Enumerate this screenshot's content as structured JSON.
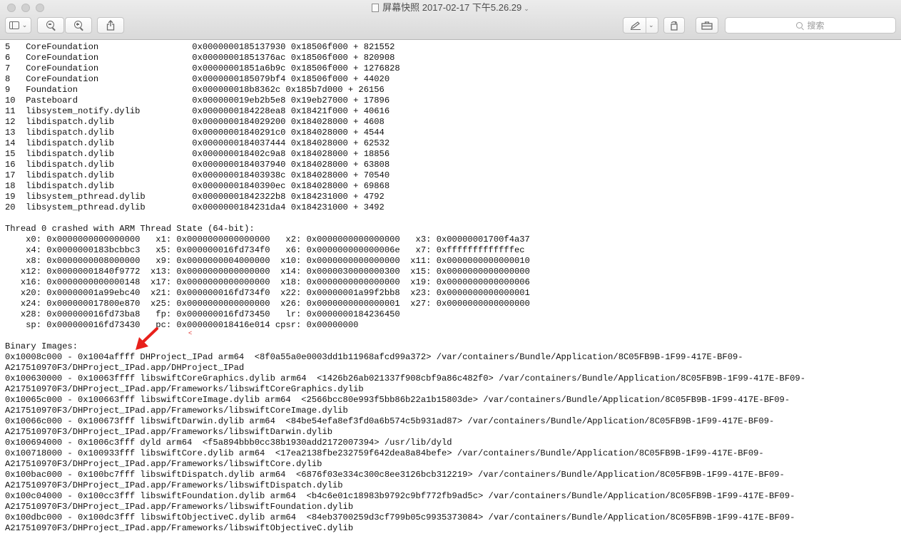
{
  "window": {
    "title": "屏幕快照 2017-02-17 下午5.26.29",
    "search_placeholder": "搜索"
  },
  "toolbar": {
    "sidebar_button": "sidebar-toggle",
    "zoom_out_button": "zoom-out",
    "zoom_in_button": "zoom-in",
    "share_button": "share",
    "markup_button": "markup-pen",
    "rotate_button": "rotate",
    "toolbox_button": "toolbox"
  },
  "annotation": {
    "arrow_color": "#e8201b",
    "mark": "<"
  },
  "log": {
    "lines": [
      "5   CoreFoundation                  0x0000000185137930 0x18506f000 + 821552",
      "6   CoreFoundation                  0x00000001851376ac 0x18506f000 + 820908",
      "7   CoreFoundation                  0x00000001851a6b9c 0x18506f000 + 1276828",
      "8   CoreFoundation                  0x0000000185079bf4 0x18506f000 + 44020",
      "9   Foundation                      0x000000018b8362c 0x185b7d000 + 26156",
      "10  Pasteboard                      0x000000019eb2b5e8 0x19eb27000 + 17896",
      "11  libsystem_notify.dylib          0x0000000184228ea8 0x18421f000 + 40616",
      "12  libdispatch.dylib               0x0000000184029200 0x184028000 + 4608",
      "13  libdispatch.dylib               0x00000001840291c0 0x184028000 + 4544",
      "14  libdispatch.dylib               0x0000000184037444 0x184028000 + 62532",
      "15  libdispatch.dylib               0x000000018402c9a8 0x184028000 + 18856",
      "16  libdispatch.dylib               0x0000000184037940 0x184028000 + 63808",
      "17  libdispatch.dylib               0x000000018403938c 0x184028000 + 70540",
      "18  libdispatch.dylib               0x00000001840390ec 0x184028000 + 69868",
      "19  libsystem_pthread.dylib         0x00000001842322b8 0x184231000 + 4792",
      "20  libsystem_pthread.dylib         0x0000000184231da4 0x184231000 + 3492",
      "",
      "Thread 0 crashed with ARM Thread State (64-bit):",
      "    x0: 0x0000000000000000   x1: 0x0000000000000000   x2: 0x0000000000000000   x3: 0x00000001700f4a37",
      "    x4: 0x0000000183bcbbc3   x5: 0x000000016fd734f0   x6: 0x000000000000006e   x7: 0xfffffffffffffec",
      "    x8: 0x0000000008000000   x9: 0x0000000004000000  x10: 0x0000000000000000  x11: 0x0000000000000010",
      "   x12: 0x00000001840f9772  x13: 0x0000000000000000  x14: 0x0000030000000300  x15: 0x0000000000000000",
      "   x16: 0x0000000000000148  x17: 0x0000000000000000  x18: 0x0000000000000000  x19: 0x0000000000000006",
      "   x20: 0x00000001a99ebc40  x21: 0x000000016fd734f0  x22: 0x00000001a99f2bb8  x23: 0x0000000000000001",
      "   x24: 0x000000017800e870  x25: 0x0000000000000000  x26: 0x0000000000000001  x27: 0x0000000000000000",
      "   x28: 0x000000016fd73ba8   fp: 0x000000016fd73450   lr: 0x0000000184236450",
      "    sp: 0x000000016fd73430   pc: 0x000000018416e014 cpsr: 0x00000000",
      "",
      "Binary Images:",
      "0x10008c000 - 0x1004affff DHProject_IPad arm64  <8f0a55a0e0003dd1b11968afcd99a372> /var/containers/Bundle/Application/8C05FB9B-1F99-417E-BF09-",
      "A217510970F3/DHProject_IPad.app/DHProject_IPad",
      "0x100630000 - 0x10063ffff libswiftCoreGraphics.dylib arm64  <1426b26ab021337f908cbf9a86c482f0> /var/containers/Bundle/Application/8C05FB9B-1F99-417E-BF09-",
      "A217510970F3/DHProject_IPad.app/Frameworks/libswiftCoreGraphics.dylib",
      "0x10065c000 - 0x100663fff libswiftCoreImage.dylib arm64  <2566bcc80e993f5bb86b22a1b15803de> /var/containers/Bundle/Application/8C05FB9B-1F99-417E-BF09-",
      "A217510970F3/DHProject_IPad.app/Frameworks/libswiftCoreImage.dylib",
      "0x10066c000 - 0x100673fff libswiftDarwin.dylib arm64  <84be54efa8ef3fd0a6b574c5b931ad87> /var/containers/Bundle/Application/8C05FB9B-1F99-417E-BF09-",
      "A217510970F3/DHProject_IPad.app/Frameworks/libswiftDarwin.dylib",
      "0x100694000 - 0x1006c3fff dyld arm64  <f5a894bbb0cc38b1930add2172007394> /usr/lib/dyld",
      "0x100718000 - 0x100933fff libswiftCore.dylib arm64  <17ea2138fbe232759f642dea8a84befe> /var/containers/Bundle/Application/8C05FB9B-1F99-417E-BF09-",
      "A217510970F3/DHProject_IPad.app/Frameworks/libswiftCore.dylib",
      "0x100bac000 - 0x100bc7fff libswiftDispatch.dylib arm64  <6876f03e334c300c8ee3126bcb312219> /var/containers/Bundle/Application/8C05FB9B-1F99-417E-BF09-",
      "A217510970F3/DHProject_IPad.app/Frameworks/libswiftDispatch.dylib",
      "0x100c04000 - 0x100cc3fff libswiftFoundation.dylib arm64  <b4c6e01c18983b9792c9bf772fb9ad5c> /var/containers/Bundle/Application/8C05FB9B-1F99-417E-BF09-",
      "A217510970F3/DHProject_IPad.app/Frameworks/libswiftFoundation.dylib",
      "0x100dbc000 - 0x100dc3fff libswiftObjectiveC.dylib arm64  <84eb3700259d3cf799b05c9935373084> /var/containers/Bundle/Application/8C05FB9B-1F99-417E-BF09-",
      "A217510970F3/DHProject_IPad.app/Frameworks/libswiftObjectiveC.dylib"
    ]
  }
}
